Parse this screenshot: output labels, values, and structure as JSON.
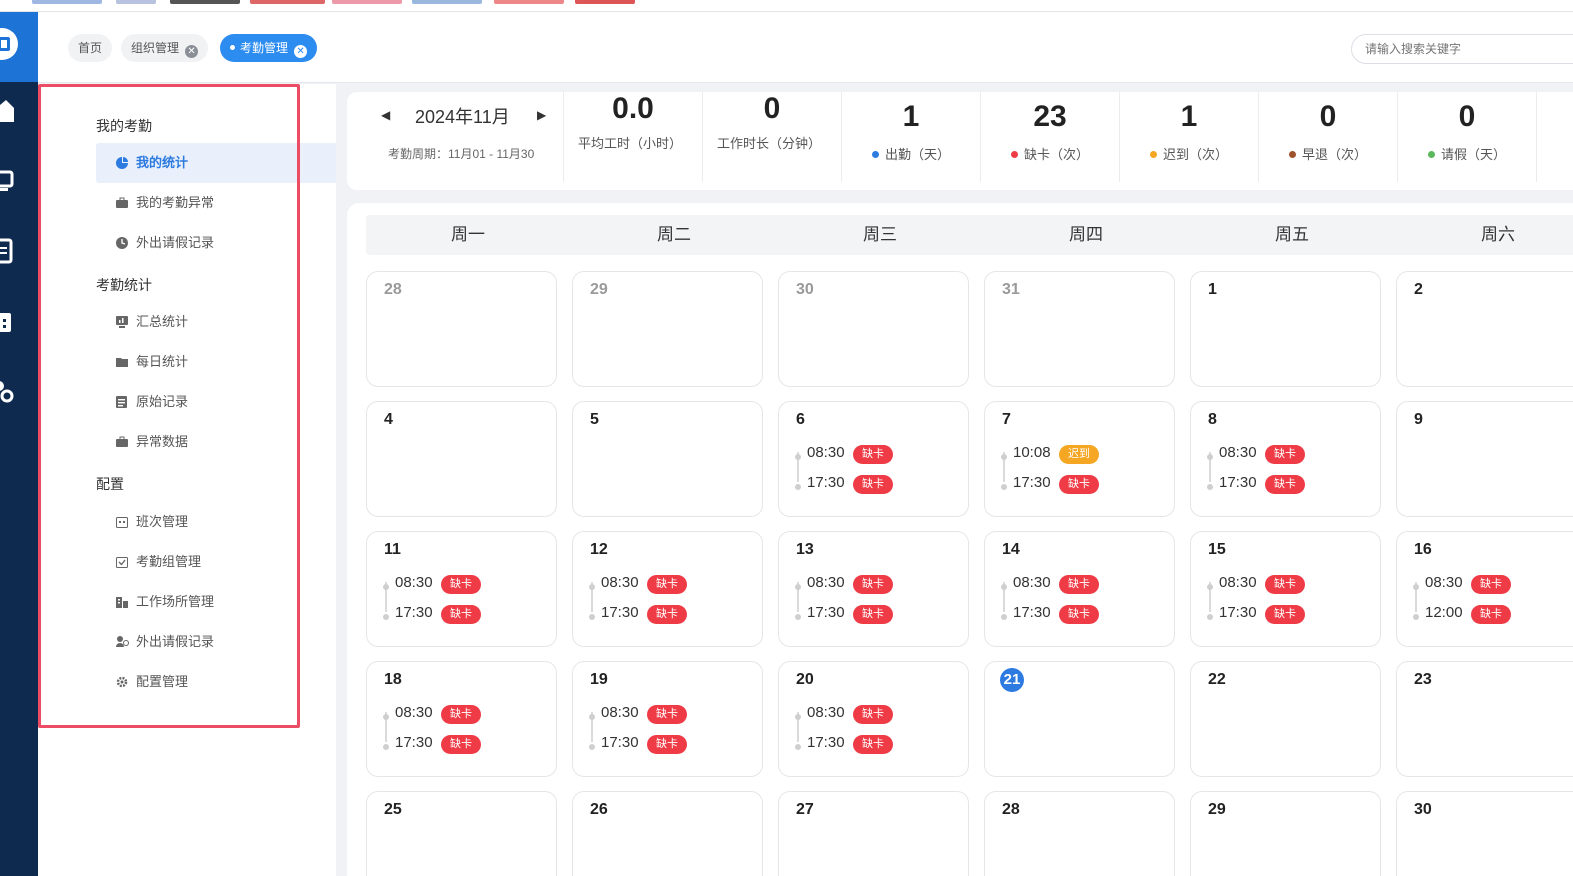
{
  "topbar": {
    "tabs": [
      {
        "label": "首页",
        "closable": false,
        "active": false
      },
      {
        "label": "组织管理",
        "closable": true,
        "active": false
      },
      {
        "label": "考勤管理",
        "closable": true,
        "active": true
      }
    ],
    "search_placeholder": "请输入搜索关键字"
  },
  "sidebar_icons": [
    "home-icon",
    "monitor-icon",
    "document-icon",
    "calendar-icon",
    "settings-icon"
  ],
  "submenu": {
    "groups": [
      {
        "title": "我的考勤",
        "items": [
          {
            "label": "我的统计",
            "icon": "pie-chart-icon",
            "active": true
          },
          {
            "label": "我的考勤异常",
            "icon": "briefcase-icon"
          },
          {
            "label": "外出请假记录",
            "icon": "clock-icon"
          }
        ]
      },
      {
        "title": "考勤统计",
        "items": [
          {
            "label": "汇总统计",
            "icon": "monitor-chart-icon"
          },
          {
            "label": "每日统计",
            "icon": "folder-icon"
          },
          {
            "label": "原始记录",
            "icon": "list-icon"
          },
          {
            "label": "异常数据",
            "icon": "briefcase-icon"
          }
        ]
      },
      {
        "title": "配置",
        "items": [
          {
            "label": "班次管理",
            "icon": "schedule-icon"
          },
          {
            "label": "考勤组管理",
            "icon": "check-box-icon"
          },
          {
            "label": "工作场所管理",
            "icon": "building-icon"
          },
          {
            "label": "外出请假记录",
            "icon": "users-icon"
          },
          {
            "label": "配置管理",
            "icon": "gear-icon"
          }
        ]
      }
    ]
  },
  "stats": {
    "month_label": "2024年11月",
    "period": "考勤周期：11月01 - 11月30",
    "items": [
      {
        "value": "0.0",
        "label": "平均工时（小时）",
        "dot_color": ""
      },
      {
        "value": "0",
        "label": "工作时长（分钟）",
        "dot_color": ""
      },
      {
        "value": "1",
        "label": "出勤（天）",
        "dot_color": "#2d7be0"
      },
      {
        "value": "23",
        "label": "缺卡（次）",
        "dot_color": "#ee3b45"
      },
      {
        "value": "1",
        "label": "迟到（次）",
        "dot_color": "#f5a623"
      },
      {
        "value": "0",
        "label": "早退（次）",
        "dot_color": "#a0522d"
      },
      {
        "value": "0",
        "label": "请假（天）",
        "dot_color": "#5cb85c"
      }
    ]
  },
  "calendar": {
    "weekdays": [
      "周一",
      "周二",
      "周三",
      "周四",
      "周五",
      "周六"
    ],
    "weeks": [
      [
        {
          "day": "28",
          "other": true
        },
        {
          "day": "29",
          "other": true
        },
        {
          "day": "30",
          "other": true
        },
        {
          "day": "31",
          "other": true
        },
        {
          "day": "1"
        },
        {
          "day": "2"
        }
      ],
      [
        {
          "day": "4"
        },
        {
          "day": "5"
        },
        {
          "day": "6",
          "records": [
            {
              "time": "08:30",
              "status": "缺卡"
            },
            {
              "time": "17:30",
              "status": "缺卡"
            }
          ]
        },
        {
          "day": "7",
          "records": [
            {
              "time": "10:08",
              "status": "迟到",
              "late": true
            },
            {
              "time": "17:30",
              "status": "缺卡"
            }
          ]
        },
        {
          "day": "8",
          "records": [
            {
              "time": "08:30",
              "status": "缺卡"
            },
            {
              "time": "17:30",
              "status": "缺卡"
            }
          ]
        },
        {
          "day": "9"
        }
      ],
      [
        {
          "day": "11",
          "records": [
            {
              "time": "08:30",
              "status": "缺卡"
            },
            {
              "time": "17:30",
              "status": "缺卡"
            }
          ]
        },
        {
          "day": "12",
          "records": [
            {
              "time": "08:30",
              "status": "缺卡"
            },
            {
              "time": "17:30",
              "status": "缺卡"
            }
          ]
        },
        {
          "day": "13",
          "records": [
            {
              "time": "08:30",
              "status": "缺卡"
            },
            {
              "time": "17:30",
              "status": "缺卡"
            }
          ]
        },
        {
          "day": "14",
          "records": [
            {
              "time": "08:30",
              "status": "缺卡"
            },
            {
              "time": "17:30",
              "status": "缺卡"
            }
          ]
        },
        {
          "day": "15",
          "records": [
            {
              "time": "08:30",
              "status": "缺卡"
            },
            {
              "time": "17:30",
              "status": "缺卡"
            }
          ]
        },
        {
          "day": "16",
          "records": [
            {
              "time": "08:30",
              "status": "缺卡"
            },
            {
              "time": "12:00",
              "status": "缺卡"
            }
          ]
        }
      ],
      [
        {
          "day": "18",
          "records": [
            {
              "time": "08:30",
              "status": "缺卡"
            },
            {
              "time": "17:30",
              "status": "缺卡"
            }
          ]
        },
        {
          "day": "19",
          "records": [
            {
              "time": "08:30",
              "status": "缺卡"
            },
            {
              "time": "17:30",
              "status": "缺卡"
            }
          ]
        },
        {
          "day": "20",
          "records": [
            {
              "time": "08:30",
              "status": "缺卡"
            },
            {
              "time": "17:30",
              "status": "缺卡"
            }
          ]
        },
        {
          "day": "21",
          "today": true
        },
        {
          "day": "22"
        },
        {
          "day": "23"
        }
      ],
      [
        {
          "day": "25"
        },
        {
          "day": "26"
        },
        {
          "day": "27"
        },
        {
          "day": "28"
        },
        {
          "day": "29"
        },
        {
          "day": "30"
        }
      ]
    ]
  }
}
